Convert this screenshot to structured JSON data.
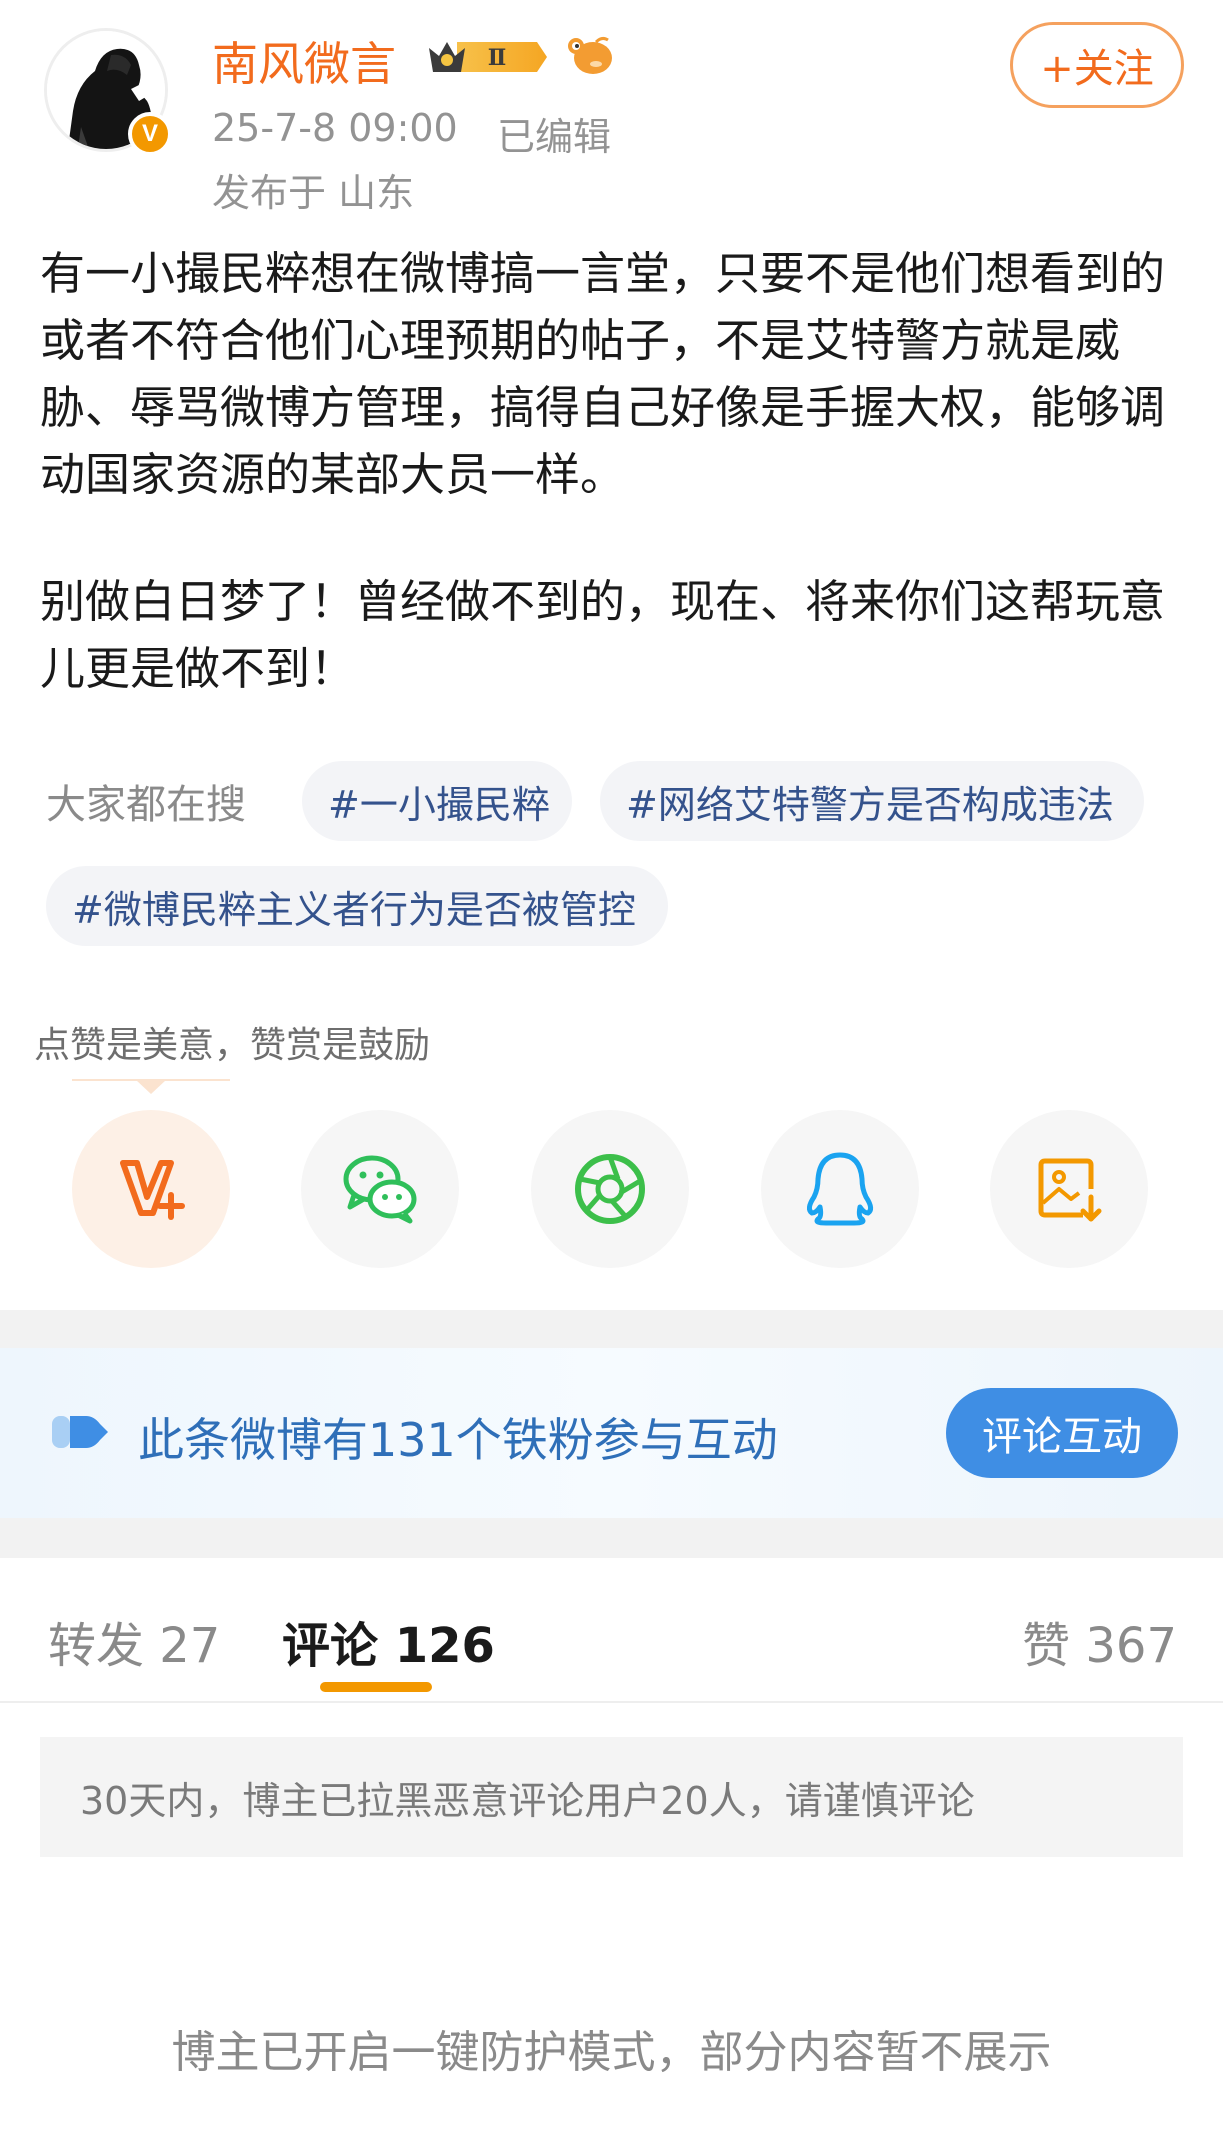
{
  "post": {
    "author": {
      "name": "南风微言",
      "verified_label": "V",
      "vip_level": "Ⅱ"
    },
    "time": "25-7-8 09:00",
    "edited": "已编辑",
    "location": "发布于 山东",
    "follow_label": "+关注",
    "paragraphs": [
      "有一小撮民粹想在微博搞一言堂，只要不是他们想看到的或者不符合他们心理预期的帖子，不是艾特警方就是威胁、辱骂微博方管理，搞得自己好像是手握大权，能够调动国家资源的某部大员一样。",
      "别做白日梦了！曾经做不到的，现在、将来你们这帮玩意儿更是做不到！"
    ]
  },
  "topics": {
    "label": "大家都在搜",
    "items": [
      "#一小撮民粹",
      "#网络艾特警方是否构成违法",
      "#微博民粹主义者行为是否被管控"
    ]
  },
  "reward": {
    "note": "点赞是美意，赞赏是鼓励"
  },
  "share": {
    "icons": [
      "reward-v-plus-icon",
      "wechat-icon",
      "moments-icon",
      "qq-icon",
      "save-image-icon"
    ],
    "colors": {
      "reward": "#f26b1d",
      "wechat": "#2fbf5a",
      "moments": "#3cbf4a",
      "qq": "#1aa3f0",
      "save": "#f39800"
    }
  },
  "fans_banner": {
    "text": "此条微博有131个铁粉参与互动",
    "button": "评论互动"
  },
  "tabs": {
    "repost": "转发 27",
    "comment": "评论 126",
    "like": "赞 367"
  },
  "notices": {
    "blacklist": "30天内，博主已拉黑恶意评论用户20人，请谨慎评论",
    "protect": "博主已开启一键防护模式，部分内容暂不展示"
  },
  "colors": {
    "accent": "#f26b1d",
    "link": "#34528c",
    "primary_blue": "#3f8ee4"
  }
}
